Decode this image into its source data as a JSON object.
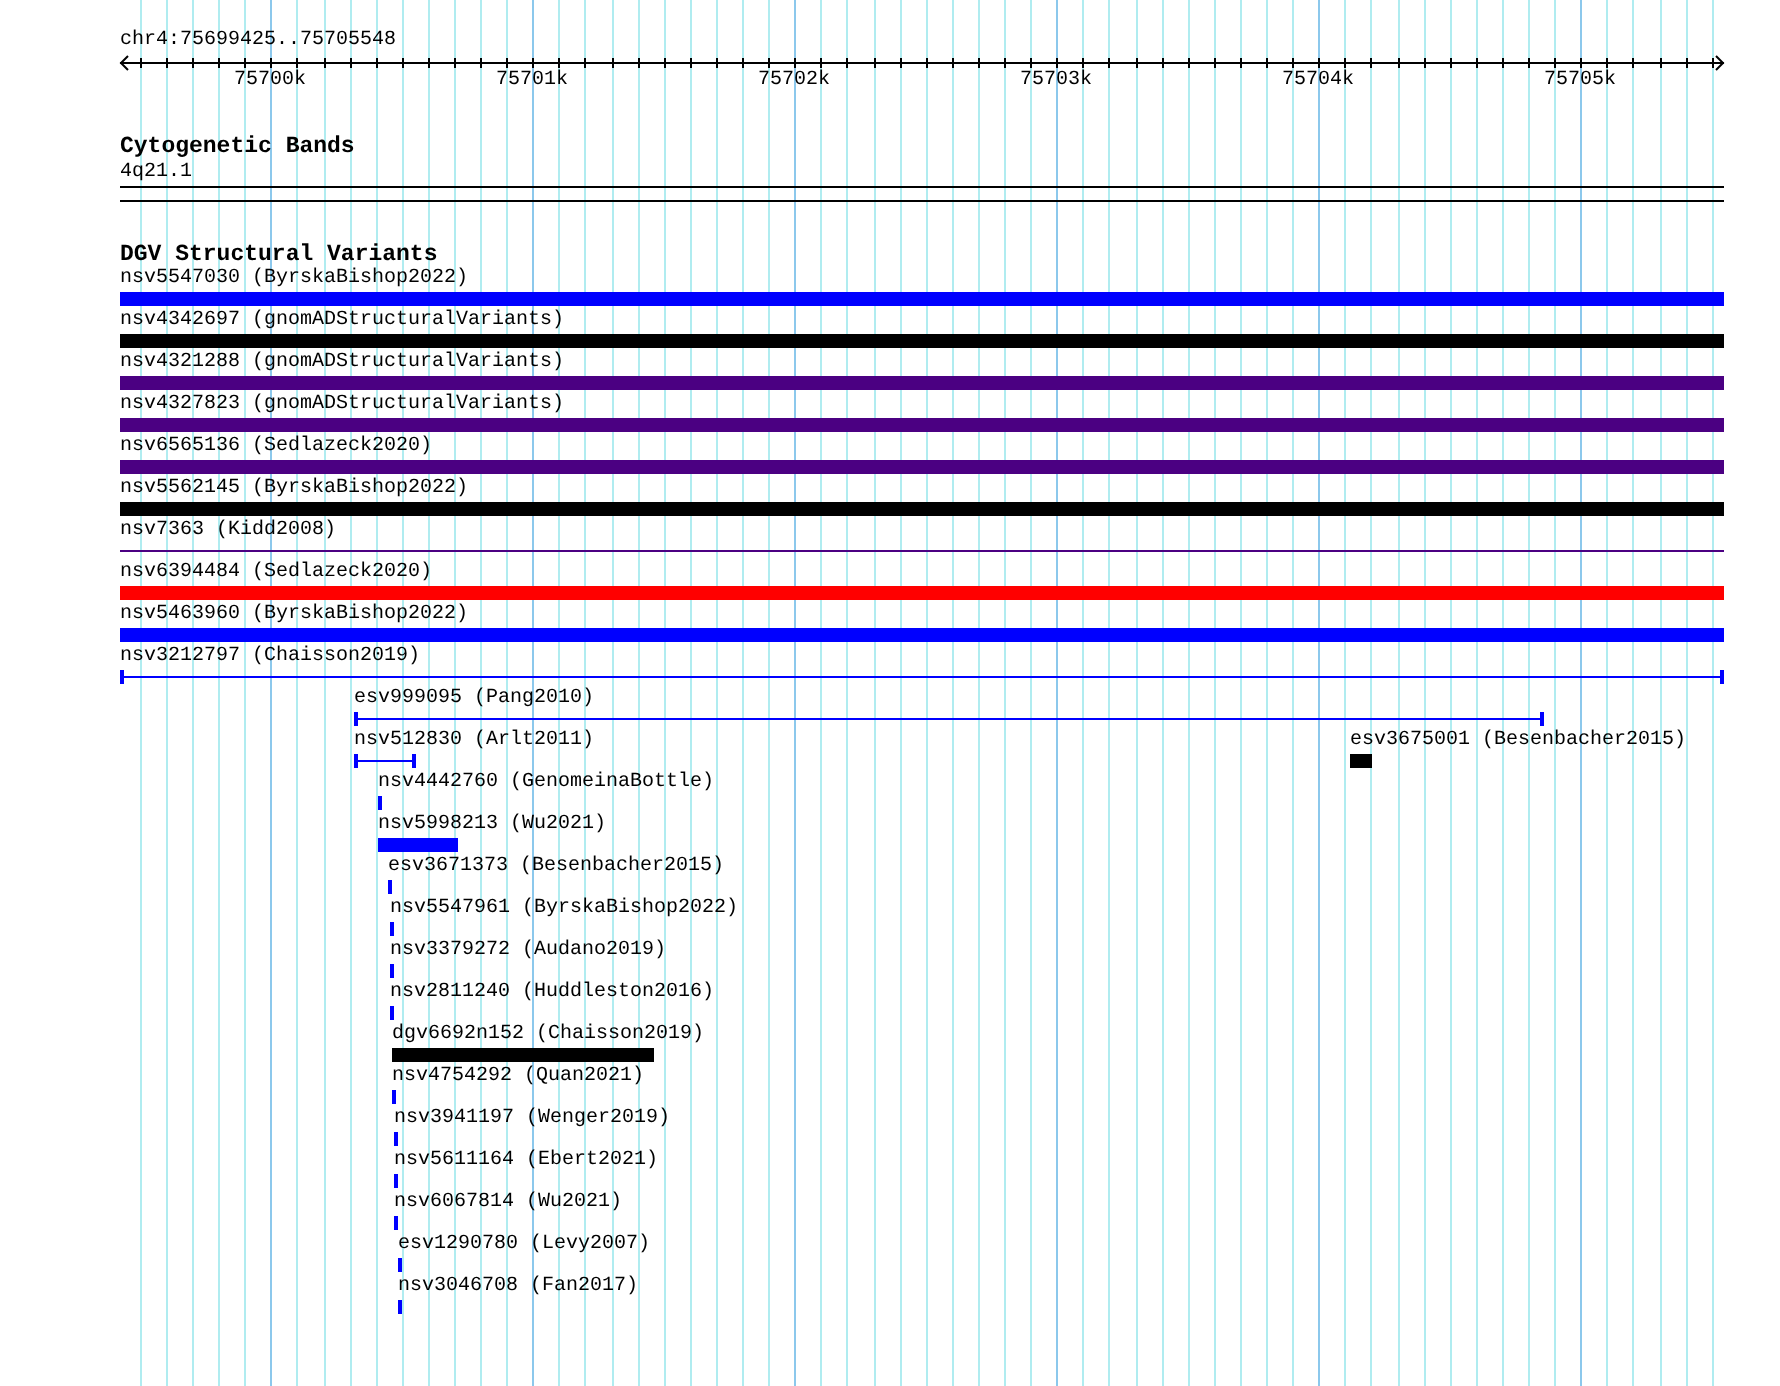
{
  "ruler": {
    "location": "chr4:75699425..75705548",
    "tick_labels": [
      "75700k",
      "75701k",
      "75702k",
      "75703k",
      "75704k",
      "75705k"
    ]
  },
  "cytogenetic_bands": {
    "title": "Cytogenetic Bands",
    "band_label": "4q21.1"
  },
  "structural_variants": {
    "title": "DGV Structural Variants",
    "features": [
      {
        "label": "nsv5547030 (ByrskaBishop2022)",
        "kind": "bar",
        "color": "#0000ff"
      },
      {
        "label": "nsv4342697 (gnomADStructuralVariants)",
        "kind": "bar",
        "color": "#000000"
      },
      {
        "label": "nsv4321288 (gnomADStructuralVariants)",
        "kind": "bar",
        "color": "#4b0082"
      },
      {
        "label": "nsv4327823 (gnomADStructuralVariants)",
        "kind": "bar",
        "color": "#4b0082"
      },
      {
        "label": "nsv6565136 (Sedlazeck2020)",
        "kind": "bar",
        "color": "#4b0082"
      },
      {
        "label": "nsv5562145 (ByrskaBishop2022)",
        "kind": "bar",
        "color": "#000000"
      },
      {
        "label": "nsv7363 (Kidd2008)",
        "kind": "line",
        "color": "#4b0082"
      },
      {
        "label": "nsv6394484 (Sedlazeck2020)",
        "kind": "bar",
        "color": "#ff0000"
      },
      {
        "label": "nsv5463960 (ByrskaBishop2022)",
        "kind": "bar",
        "color": "#0000ff"
      },
      {
        "label": "nsv3212797 (Chaisson2019)",
        "kind": "capped-line",
        "color": "#0000ff"
      },
      {
        "label": "esv999095 (Pang2010)",
        "kind": "capped-line",
        "color": "#0000ff"
      },
      {
        "label": "nsv512830 (Arlt2011)",
        "kind": "capped-line",
        "color": "#0000ff"
      },
      {
        "label": "esv3675001 (Besenbacher2015)",
        "kind": "bar",
        "color": "#000000"
      },
      {
        "label": "nsv4442760 (GenomeinaBottle)",
        "kind": "bar",
        "color": "#0000ff"
      },
      {
        "label": "nsv5998213 (Wu2021)",
        "kind": "bar",
        "color": "#0000ff"
      },
      {
        "label": "esv3671373 (Besenbacher2015)",
        "kind": "bar",
        "color": "#0000ff"
      },
      {
        "label": "nsv5547961 (ByrskaBishop2022)",
        "kind": "bar",
        "color": "#0000ff"
      },
      {
        "label": "nsv3379272 (Audano2019)",
        "kind": "bar",
        "color": "#0000ff"
      },
      {
        "label": "nsv2811240 (Huddleston2016)",
        "kind": "bar",
        "color": "#0000ff"
      },
      {
        "label": "dgv6692n152 (Chaisson2019)",
        "kind": "bar",
        "color": "#000000"
      },
      {
        "label": "nsv4754292 (Quan2021)",
        "kind": "bar",
        "color": "#0000ff"
      },
      {
        "label": "nsv3941197 (Wenger2019)",
        "kind": "bar",
        "color": "#0000ff"
      },
      {
        "label": "nsv5611164 (Ebert2021)",
        "kind": "bar",
        "color": "#0000ff"
      },
      {
        "label": "nsv6067814 (Wu2021)",
        "kind": "bar",
        "color": "#0000ff"
      },
      {
        "label": "esv1290780 (Levy2007)",
        "kind": "bar",
        "color": "#0000ff"
      },
      {
        "label": "nsv3046708 (Fan2017)",
        "kind": "bar",
        "color": "#0000ff"
      }
    ]
  }
}
